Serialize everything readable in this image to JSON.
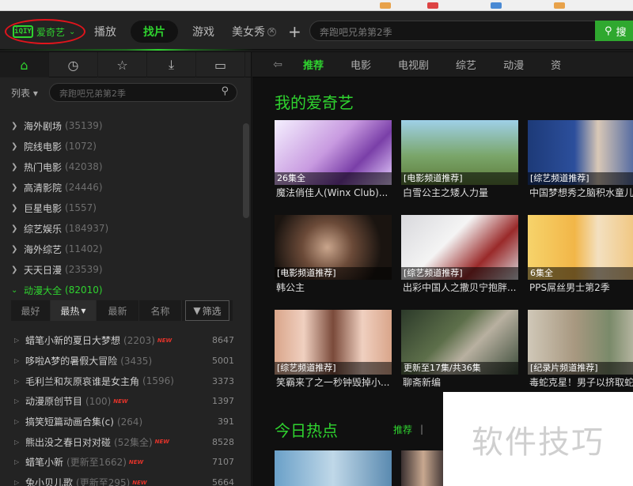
{
  "app": {
    "logo_badge": "iQIY",
    "logo_text": "爱奇艺",
    "logo_caret": "⌄"
  },
  "top_tabs": [
    {
      "label": "播放"
    },
    {
      "label": "找片"
    },
    {
      "label": "游戏"
    },
    {
      "label": "美女秀"
    }
  ],
  "top_search": {
    "placeholder": "奔跑吧兄弟第2季",
    "button": "搜"
  },
  "sidebar": {
    "icons": [
      "home-icon",
      "clock-icon",
      "star-icon",
      "download-icon",
      "folder-icon"
    ],
    "list_label": "列表 ▾",
    "search_placeholder": "奔跑吧兄弟第2季",
    "categories": [
      {
        "name": "海外剧场",
        "count": "(35139)"
      },
      {
        "name": "院线电影",
        "count": "(1072)"
      },
      {
        "name": "热门电影",
        "count": "(42038)"
      },
      {
        "name": "高清影院",
        "count": "(24446)"
      },
      {
        "name": "巨星电影",
        "count": "(1557)"
      },
      {
        "name": "综艺娱乐",
        "count": "(184937)"
      },
      {
        "name": "海外综艺",
        "count": "(11402)"
      },
      {
        "name": "天天日漫",
        "count": "(23539)"
      },
      {
        "name": "动漫大全",
        "count": "(82010)"
      }
    ],
    "sort": {
      "best": "最好",
      "hot": "最热",
      "newest": "最新",
      "name": "名称",
      "filter": "筛选"
    },
    "shows": [
      {
        "title": "蜡笔小新的夏日大梦想",
        "sub": "(2203)",
        "new": "NEW",
        "num": "8647"
      },
      {
        "title": "哆啦A梦的暑假大冒险",
        "sub": "(3435)",
        "new": "",
        "num": "5001"
      },
      {
        "title": "毛利兰和灰原哀谁是女主角",
        "sub": "(1596)",
        "new": "",
        "num": "3373"
      },
      {
        "title": "动漫原创节目",
        "sub": "(100)",
        "new": "NEW",
        "num": "1397"
      },
      {
        "title": "搞笑短篇动画合集(c)",
        "sub": "(264)",
        "new": "",
        "num": "391"
      },
      {
        "title": "熊出没之春日对对碰",
        "sub": "(52集全)",
        "new": "NEW",
        "num": "8528"
      },
      {
        "title": "蜡笔小新",
        "sub": "(更新至1662)",
        "new": "NEW",
        "num": "7107"
      },
      {
        "title": "兔小贝儿歌",
        "sub": "(更新至295)",
        "new": "NEW",
        "num": "5664"
      }
    ]
  },
  "main": {
    "nav": [
      "推荐",
      "电影",
      "电视剧",
      "综艺",
      "动漫",
      "资"
    ],
    "my_title": "我的爱奇艺",
    "cards": [
      {
        "tag": "26集全",
        "caption": "魔法俏佳人(Winx Club)..."
      },
      {
        "tag": "[电影频道推荐]",
        "caption": "白雪公主之矮人力量"
      },
      {
        "tag": "[综艺频道推荐]",
        "caption": "中国梦想秀之脑积水童儿"
      },
      {
        "tag": "[电影频道推荐]",
        "caption": "韩公主"
      },
      {
        "tag": "[综艺频道推荐]",
        "caption": "出彩中国人之撒贝宁抱胖..."
      },
      {
        "tag": "6集全",
        "caption": "PPS屌丝男士第2季"
      },
      {
        "tag": "[综艺频道推荐]",
        "caption": "笑霸来了之一秒钟毁掉小..."
      },
      {
        "tag": "更新至17集/共36集",
        "caption": "聊斋新编"
      },
      {
        "tag": "[纪录片频道推荐]",
        "caption": "毒蛇克星！男子以挤取蛇"
      }
    ],
    "hot_title": "今日热点",
    "hot_tab": "推荐",
    "hot_sep": "|"
  },
  "watermark": "软件技巧",
  "colors": {
    "accent": "#2fd32f",
    "highlight_circle": "#e1141c",
    "new_badge": "#e3332a"
  }
}
